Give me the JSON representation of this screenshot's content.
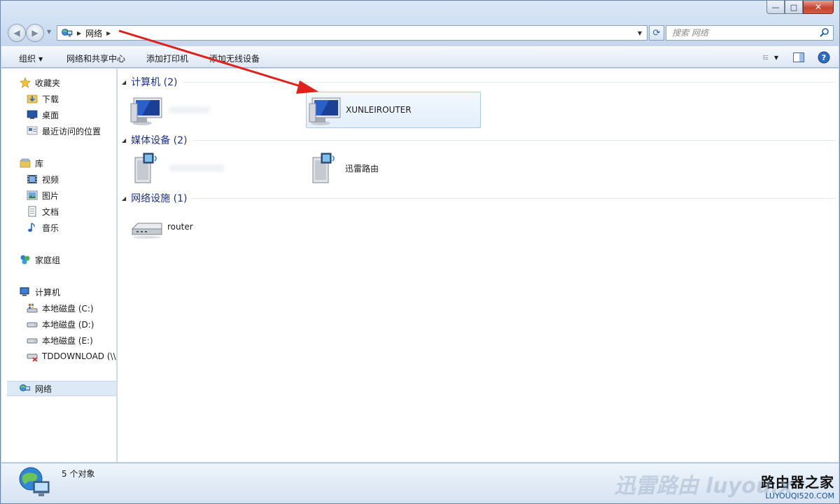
{
  "window": {
    "caption_buttons": {
      "minimize": "—",
      "maximize": "□",
      "close": "✕"
    }
  },
  "address": {
    "breadcrumb": "网络",
    "search_placeholder": "搜索 网络"
  },
  "toolbar": {
    "organize": "组织",
    "network_center": "网络和共享中心",
    "add_printer": "添加打印机",
    "add_wireless": "添加无线设备"
  },
  "nav": {
    "favorites": "收藏夹",
    "downloads": "下载",
    "desktop": "桌面",
    "recent": "最近访问的位置",
    "libraries": "库",
    "videos": "视频",
    "pictures": "图片",
    "documents": "文档",
    "music": "音乐",
    "homegroup": "家庭组",
    "computer": "计算机",
    "drive_c": "本地磁盘 (C:)",
    "drive_d": "本地磁盘 (D:)",
    "drive_e": "本地磁盘 (E:)",
    "tddownload": "TDDOWNLOAD (\\\\",
    "network": "网络"
  },
  "groups": {
    "computers": "计算机 (2)",
    "media": "媒体设备 (2)",
    "infrastructure": "网络设施 (1)"
  },
  "items": {
    "computer2": "XUNLEIROUTER",
    "media2": "迅雷路由",
    "router": "router"
  },
  "status": {
    "count": "5 个对象"
  },
  "watermark": {
    "brand": "路由器之家",
    "url": "LUYOUQI520.COM",
    "ghost": "迅雷路由 luyou.x"
  },
  "colors": {
    "group_title": "#1e3287",
    "annotation_arrow": "#e0201b",
    "selection": "#e3effb"
  }
}
